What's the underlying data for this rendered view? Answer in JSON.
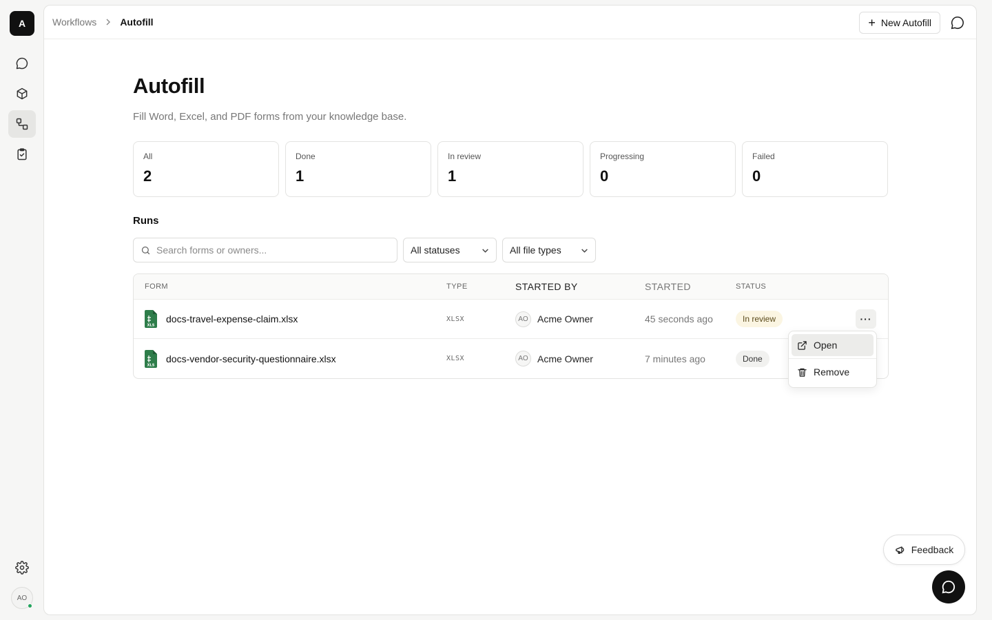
{
  "app": {
    "logo_letter": "A",
    "user_initials": "AO"
  },
  "breadcrumb": {
    "parent": "Workflows",
    "current": "Autofill"
  },
  "header": {
    "new_button": "New Autofill"
  },
  "page": {
    "title": "Autofill",
    "subtitle": "Fill Word, Excel, and PDF forms from your knowledge base."
  },
  "stats": [
    {
      "label": "All",
      "value": "2"
    },
    {
      "label": "Done",
      "value": "1"
    },
    {
      "label": "In review",
      "value": "1"
    },
    {
      "label": "Progressing",
      "value": "0"
    },
    {
      "label": "Failed",
      "value": "0"
    }
  ],
  "runs": {
    "title": "Runs",
    "search_placeholder": "Search forms or owners...",
    "status_filter": "All statuses",
    "type_filter": "All file types",
    "columns": {
      "form": "FORM",
      "type": "TYPE",
      "started_by": "STARTED BY",
      "started": "STARTED",
      "status": "STATUS"
    },
    "rows": [
      {
        "form": "docs-travel-expense-claim.xlsx",
        "type": "XLSX",
        "owner_initials": "AO",
        "owner": "Acme Owner",
        "started": "45 seconds ago",
        "status": "In review",
        "file_icon_label": "XLS"
      },
      {
        "form": "docs-vendor-security-questionnaire.xlsx",
        "type": "XLSX",
        "owner_initials": "AO",
        "owner": "Acme Owner",
        "started": "7 minutes ago",
        "status": "Done",
        "file_icon_label": "XLS"
      }
    ]
  },
  "menu": {
    "open": "Open",
    "remove": "Remove"
  },
  "feedback": "Feedback",
  "colors": {
    "brand": "#111111",
    "excel_green": "#2e7d4a",
    "review_badge": "#fbf5e2",
    "online": "#22a45d"
  }
}
